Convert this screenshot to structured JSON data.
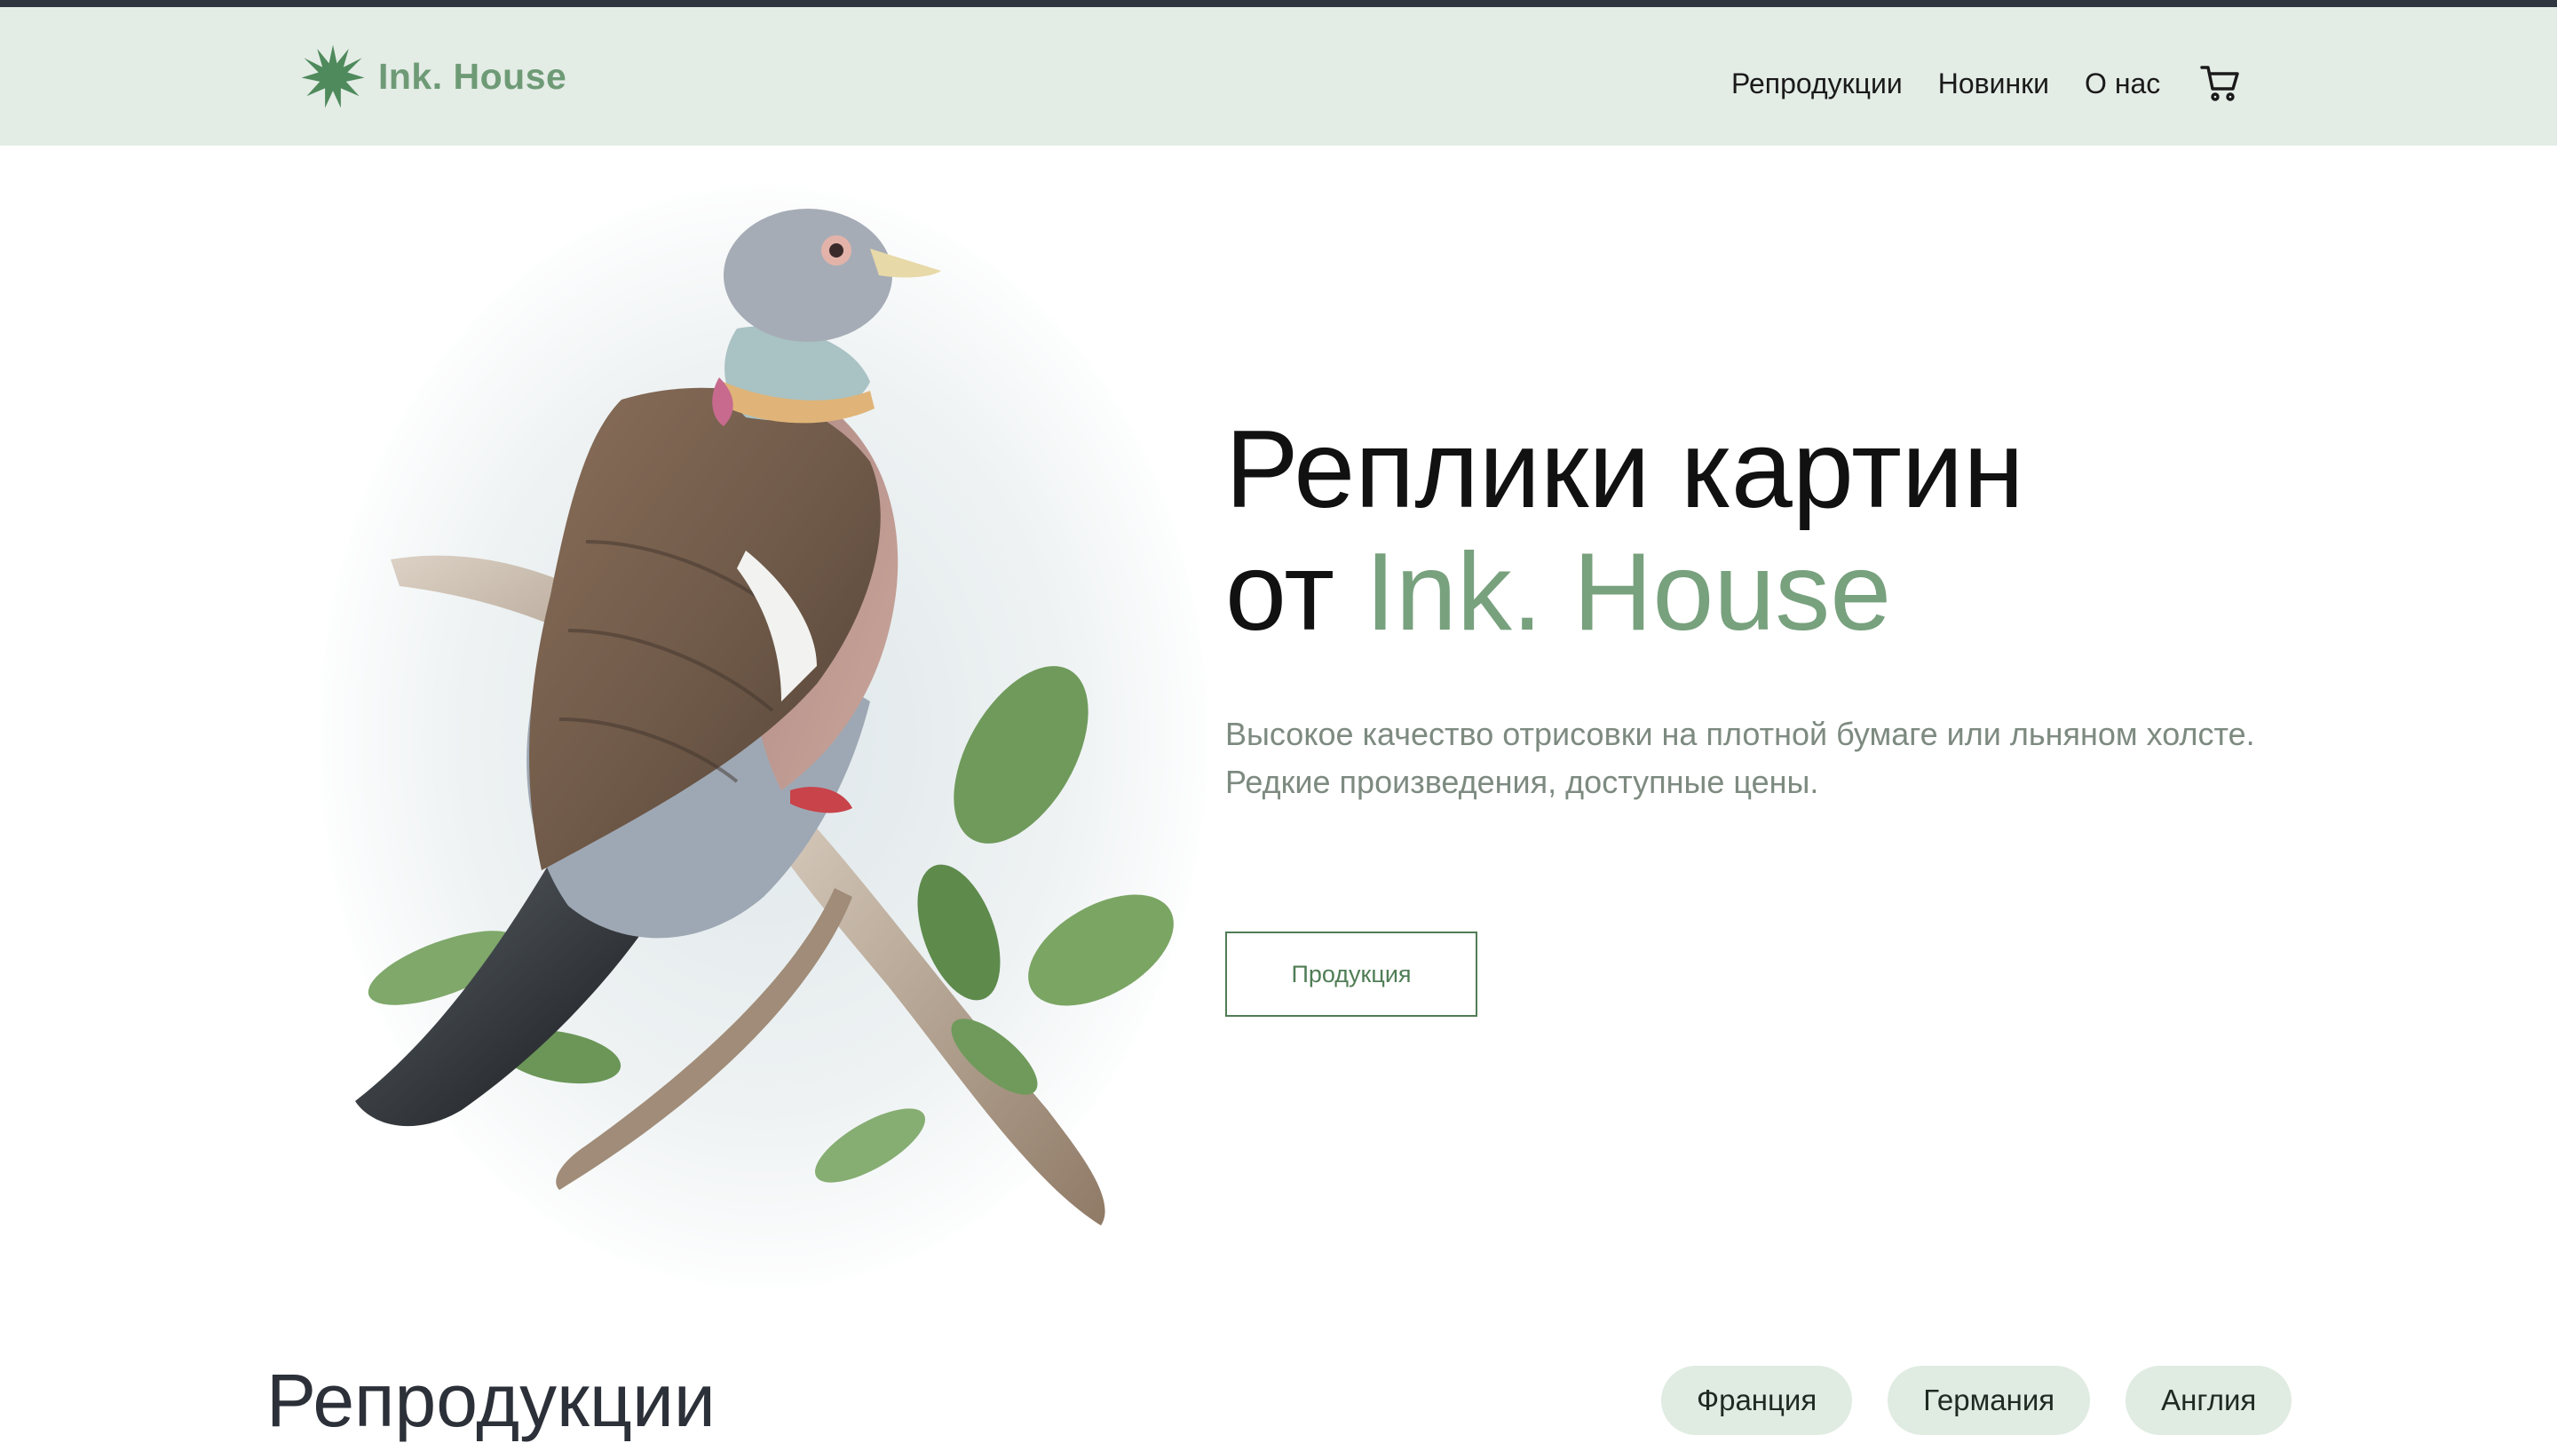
{
  "brand": {
    "name": "Ink. House",
    "accent_color": "#78a17e"
  },
  "nav": {
    "items": [
      {
        "label": "Репродукции"
      },
      {
        "label": "Новинки"
      },
      {
        "label": "О нас"
      }
    ],
    "cart_icon": "cart-icon"
  },
  "hero": {
    "title_line1": "Реплики картин",
    "title_prefix": "от",
    "title_accent": "Ink. House",
    "subtitle_line1": "Высокое качество отрисовки на плотной бумаге или льняном холсте.",
    "subtitle_line2": "Редкие произведения, доступные цены.",
    "cta_label": "Продукция",
    "image_icon": "pigeon-illustration"
  },
  "section": {
    "title": "Репродукции",
    "filters": [
      {
        "label": "Франция"
      },
      {
        "label": "Германия"
      },
      {
        "label": "Англия"
      }
    ]
  },
  "colors": {
    "header_bg": "#e4ece6",
    "chip_bg": "#e0ebe2",
    "button_border": "#4f7d55"
  }
}
